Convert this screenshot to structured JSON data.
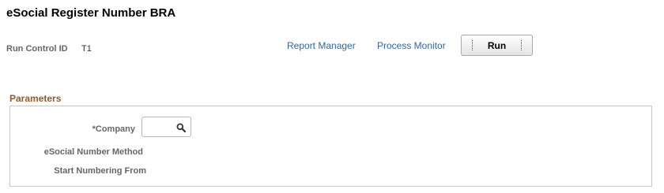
{
  "page": {
    "title": "eSocial Register Number BRA"
  },
  "run_control": {
    "label": "Run Control ID",
    "value": "T1"
  },
  "links": {
    "report_manager": "Report Manager",
    "process_monitor": "Process Monitor"
  },
  "toolbar": {
    "run_label": "Run"
  },
  "parameters": {
    "title": "Parameters",
    "company_label": "*Company",
    "company_value": "",
    "method_label": "eSocial Number Method",
    "start_label": "Start Numbering From"
  },
  "icons": {
    "search": "search-icon"
  },
  "colors": {
    "link": "#336699",
    "group_title": "#a0561f",
    "label": "#666666"
  }
}
